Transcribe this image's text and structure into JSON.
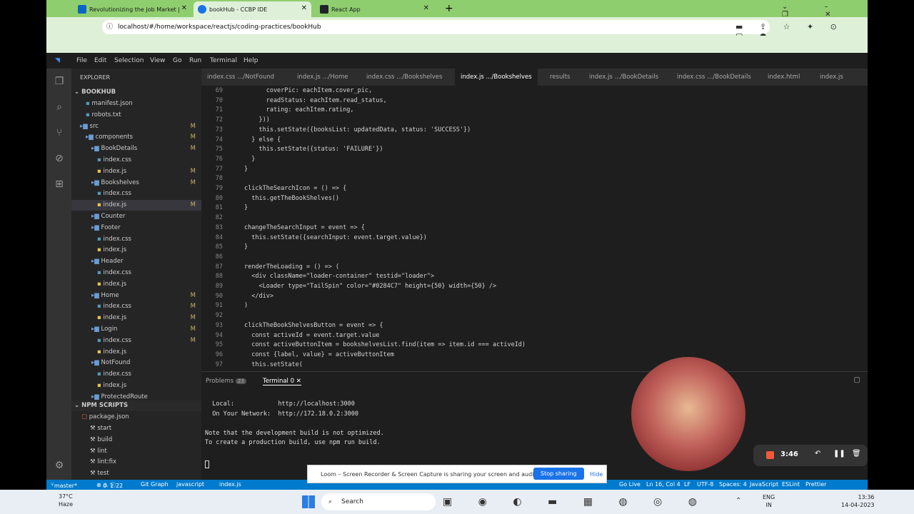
{
  "chrome": {
    "tabs": [
      {
        "title": "Revolutionizing the Job Market |",
        "close": "✕"
      },
      {
        "title": "bookHub - CCBP IDE",
        "close": "✕"
      },
      {
        "title": "React App",
        "close": "✕"
      }
    ],
    "url": "localhost/#/home/workspace/reactjs/coding-practices/bookHub"
  },
  "menu": [
    "File",
    "Edit",
    "Selection",
    "View",
    "Go",
    "Run",
    "Terminal",
    "Help"
  ],
  "explorer": {
    "title": "EXPLORER",
    "root": "BOOKHUB",
    "items": [
      {
        "label": "manifest.json",
        "m": ""
      },
      {
        "label": "robots.txt",
        "m": ""
      },
      {
        "label": "src",
        "m": "M"
      },
      {
        "label": "components",
        "m": "M"
      },
      {
        "label": "BookDetails",
        "m": "M"
      },
      {
        "label": "index.css",
        "m": ""
      },
      {
        "label": "index.js",
        "m": "M"
      },
      {
        "label": "Bookshelves",
        "m": "M"
      },
      {
        "label": "index.css",
        "m": ""
      },
      {
        "label": "index.js",
        "m": "M"
      },
      {
        "label": "Counter",
        "m": ""
      },
      {
        "label": "Footer",
        "m": ""
      },
      {
        "label": "index.css",
        "m": ""
      },
      {
        "label": "index.js",
        "m": ""
      },
      {
        "label": "Header",
        "m": ""
      },
      {
        "label": "index.css",
        "m": ""
      },
      {
        "label": "index.js",
        "m": ""
      },
      {
        "label": "Home",
        "m": "M"
      },
      {
        "label": "index.css",
        "m": "M"
      },
      {
        "label": "index.js",
        "m": "M"
      },
      {
        "label": "Login",
        "m": "M"
      },
      {
        "label": "index.css",
        "m": "M"
      },
      {
        "label": "index.js",
        "m": ""
      },
      {
        "label": "NotFound",
        "m": ""
      },
      {
        "label": "index.css",
        "m": ""
      },
      {
        "label": "index.js",
        "m": ""
      },
      {
        "label": "ProtectedRoute",
        "m": ""
      }
    ],
    "npm_title": "NPM SCRIPTS",
    "npm_pkg": "package.json",
    "npm_scripts": [
      "start",
      "build",
      "lint",
      "lint:fix",
      "test"
    ]
  },
  "editor_tabs": [
    "index.css .../NotFound",
    "index.js .../Home",
    "index.css .../Bookshelves",
    "index.js .../Bookshelves",
    "results",
    "index.js .../BookDetails",
    "index.css .../BookDetails",
    "index.html",
    "index.js .../Logi"
  ],
  "code_lines": [
    {
      "n": "69",
      "t": "      coverPic: eachItem.cover_pic,"
    },
    {
      "n": "70",
      "t": "      readStatus: eachItem.read_status,"
    },
    {
      "n": "71",
      "t": "      rating: eachItem.rating,"
    },
    {
      "n": "72",
      "t": "    }))"
    },
    {
      "n": "73",
      "t": "    this.setState({booksList: updatedData, status: 'SUCCESS'})"
    },
    {
      "n": "74",
      "t": "  } else {"
    },
    {
      "n": "75",
      "t": "    this.setState({status: 'FAILURE'})"
    },
    {
      "n": "76",
      "t": "  }"
    },
    {
      "n": "77",
      "t": "}"
    },
    {
      "n": "78",
      "t": ""
    },
    {
      "n": "79",
      "t": "clickTheSearchIcon = () => {"
    },
    {
      "n": "80",
      "t": "  this.getTheBookShelves()"
    },
    {
      "n": "81",
      "t": "}"
    },
    {
      "n": "82",
      "t": ""
    },
    {
      "n": "83",
      "t": "changeTheSearchInput = event => {"
    },
    {
      "n": "84",
      "t": "  this.setState({searchInput: event.target.value})"
    },
    {
      "n": "85",
      "t": "}"
    },
    {
      "n": "86",
      "t": ""
    },
    {
      "n": "87",
      "t": "renderTheLoading = () => ("
    },
    {
      "n": "88",
      "t": "  <div className=\"loader-container\" testid=\"loader\">"
    },
    {
      "n": "89",
      "t": "    <Loader type=\"TailSpin\" color=\"#0284C7\" height={50} width={50} />"
    },
    {
      "n": "90",
      "t": "  </div>"
    },
    {
      "n": "91",
      "t": ")"
    },
    {
      "n": "92",
      "t": ""
    },
    {
      "n": "93",
      "t": "clickTheBookShelvesButton = event => {"
    },
    {
      "n": "94",
      "t": "  const activeId = event.target.value"
    },
    {
      "n": "95",
      "t": "  const activeButtonItem = bookshelvesList.find(item => item.id === activeId)"
    },
    {
      "n": "96",
      "t": "  const {label, value} = activeButtonItem"
    },
    {
      "n": "97",
      "t": "  this.setState("
    }
  ],
  "panel": {
    "problems": "Problems",
    "problems_count": "23",
    "terminal": "Terminal 0",
    "lines": [
      "  Local:            http://localhost:3000",
      "  On Your Network:  http://172.18.0.2:3000",
      "",
      "Note that the development build is not optimized.",
      "To create a production build, use npm run build."
    ]
  },
  "status": {
    "branch": "master*",
    "errors": "0",
    "warnings": "1",
    "info": "22",
    "git": "Git Graph",
    "lang": "javascript",
    "file": "index.js",
    "golive": "Go Live",
    "pos": "Ln 16, Col 4",
    "eol": "LF",
    "enc": "UTF-8",
    "spaces": "Spaces: 4",
    "mode": "JavaScript",
    "eslint": "ESLint",
    "prettier": "Prettier"
  },
  "loom": {
    "text": "Loom – Screen Recorder & Screen Capture is sharing your screen and audio.",
    "stop": "Stop sharing",
    "hide": "Hide"
  },
  "recorder": {
    "time": "3:46"
  },
  "taskbar": {
    "weather": "37°C",
    "weather2": "Haze",
    "search": "Search",
    "lang1": "ENG",
    "lang2": "IN",
    "time": "13:36",
    "date": "14-04-2023"
  }
}
